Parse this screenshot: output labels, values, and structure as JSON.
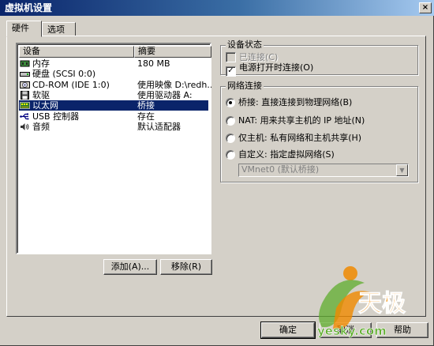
{
  "window": {
    "title": "虚拟机设置",
    "close_glyph": "×"
  },
  "tabs": [
    {
      "label": "硬件",
      "active": true
    },
    {
      "label": "选项",
      "active": false
    }
  ],
  "device_list": {
    "headers": {
      "device": "设备",
      "summary": "摘要"
    },
    "rows": [
      {
        "icon": "memory-icon",
        "device": "内存",
        "summary": "180 MB"
      },
      {
        "icon": "hard-disk-icon",
        "device": "硬盘 (SCSI 0:0)",
        "summary": ""
      },
      {
        "icon": "cd-rom-icon",
        "device": "CD-ROM (IDE 1:0)",
        "summary": "使用映像 D:\\redh..."
      },
      {
        "icon": "floppy-icon",
        "device": "软驱",
        "summary": "使用驱动器 A:"
      },
      {
        "icon": "network-adapter-icon",
        "device": "以太网",
        "summary": "桥接",
        "selected": true
      },
      {
        "icon": "usb-icon",
        "device": "USB 控制器",
        "summary": "存在"
      },
      {
        "icon": "sound-icon",
        "device": "音频",
        "summary": "默认适配器"
      }
    ]
  },
  "list_buttons": {
    "add": "添加(A)...",
    "remove": "移除(R)"
  },
  "device_status": {
    "title": "设备状态",
    "connected": {
      "label": "已连接(C)",
      "checked": false,
      "enabled": false
    },
    "connect_at_power_on": {
      "label": "电源打开时连接(O)",
      "checked": true,
      "enabled": true
    }
  },
  "network_connection": {
    "title": "网络连接",
    "options": [
      {
        "label": "桥接: 直接连接到物理网络(B)",
        "selected": true
      },
      {
        "label": "NAT: 用来共享主机的 IP 地址(N)",
        "selected": false
      },
      {
        "label": "仅主机: 私有网络和主机共享(H)",
        "selected": false
      },
      {
        "label": "自定义: 指定虚拟网络(S)",
        "selected": false
      }
    ],
    "custom_network_select": {
      "value": "VMnet0 (默认桥接)",
      "enabled": false
    }
  },
  "dialog_buttons": {
    "ok": "确定",
    "cancel": "取消",
    "help": "帮助"
  },
  "watermark": {
    "brand": "天极",
    "site": "yesky.com"
  },
  "colors": {
    "face": "#d4d0c8",
    "selection": "#0a246a",
    "title_start": "#0a246a",
    "title_end": "#a6caf0",
    "watermark_orange": "#f08a00",
    "watermark_green": "#5fae2e"
  }
}
